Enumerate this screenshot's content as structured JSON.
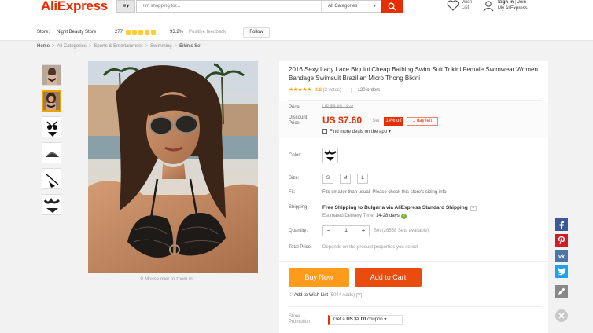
{
  "header": {
    "logo": "AliExpress",
    "category_button_icon": "menu-icon",
    "search_placeholder": "I'm shopping for...",
    "search_category": "All Categories",
    "wish_label_1": "Wish",
    "wish_label_2": "List",
    "signin": "Sign in",
    "join": "Join",
    "my_account": "My AliExpress"
  },
  "store": {
    "label": "Store:",
    "name": "Night Beauty Store",
    "score": "277",
    "positive_pct": "93.2%",
    "positive_label": "Positive feedback",
    "follow": "Follow"
  },
  "breadcrumb": [
    "Home",
    "All Categories",
    "Sports & Entertainment",
    "Swimming",
    "Bikinis Set"
  ],
  "gallery": {
    "zoom_hint": "Mouse over to zoom in"
  },
  "product": {
    "title": "2016 Sexy Lady Lace Biquini Cheap Bathing Swim Suit Trikini Female Swimwear Women Bandage Swimsuit Brazilian Micro Thong Bikini",
    "stars": "★★★★★",
    "rating": "4.8",
    "votes": "(3 votes)",
    "orders": "120 orders",
    "price_label": "Price:",
    "old_price": "US $8.80 / Set",
    "discount_label_1": "Discount",
    "discount_label_2": "Price:",
    "price": "US $7.60",
    "per": "/ Set",
    "off": "14% off",
    "days_left": "1 day left",
    "more_deals": "Find more deals on the app",
    "color_label": "Color:",
    "size_label": "Size:",
    "sizes": [
      "S",
      "M",
      "L"
    ],
    "fit_label": "Fit:",
    "fit_text": "Fits smaller than usual. Please check this store's sizing info",
    "shipping_label": "Shipping:",
    "shipping_text_1": "Free Shipping to Bulgaria via AliExpress Standard Shipping",
    "delivery_label": "Estimated Delivery Time:",
    "delivery_days": "14-28 days",
    "quantity_label": "Quantity:",
    "quantity": "1",
    "available": "Set (26558 Sets available)",
    "total_label": "Total Price:",
    "total_text": "Depends on the product properties you select",
    "buy_now": "Buy Now",
    "add_to_cart": "Add to Cart",
    "wishlist": "Add to Wish List",
    "wishlist_count": "(5044 Adds)",
    "promo_label_1": "Store",
    "promo_label_2": "Promotion:",
    "coupon_prefix": "Get a",
    "coupon_amount": "US $2.00",
    "coupon_suffix": "coupon"
  },
  "share": [
    "facebook-icon",
    "pinterest-icon",
    "vk-icon",
    "twitter-icon",
    "edit-icon",
    "close-icon"
  ],
  "colors": {
    "brand": "#e62e04",
    "buy_now": "#ff9b1b",
    "add_to_cart": "#e94c0e",
    "facebook": "#3b5998",
    "pinterest": "#cb2027",
    "vk": "#4a76a8",
    "twitter": "#1da1f2"
  }
}
